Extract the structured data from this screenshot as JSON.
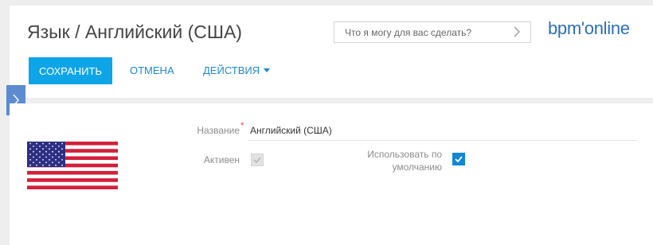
{
  "header": {
    "title": "Язык / Английский (США)",
    "search": {
      "placeholder": "Что я могу для вас сделать?",
      "chevron_icon": "chevron-right-icon"
    },
    "logo": "bpm'online"
  },
  "toolbar": {
    "save_label": "СОХРАНИТЬ",
    "cancel_label": "ОТМЕНА",
    "actions_label": "ДЕЙСТВИЯ",
    "actions_icon": "caret-down-icon"
  },
  "sidebar": {
    "toggle_icon": "chevron-right-icon"
  },
  "form": {
    "flag_icon": "us-flag-icon",
    "name": {
      "label": "Название",
      "required_mark": "*",
      "value": "Английский (США)"
    },
    "active": {
      "label": "Активен",
      "checked": true,
      "disabled": true
    },
    "default": {
      "label": "Использовать по умолчанию",
      "checked": true
    }
  },
  "colors": {
    "accent": "#0ea5e8",
    "link": "#1e88d2",
    "logo": "#2b6fb6",
    "required": "#e5442d",
    "checkbox_checked": "#0e87d6"
  }
}
